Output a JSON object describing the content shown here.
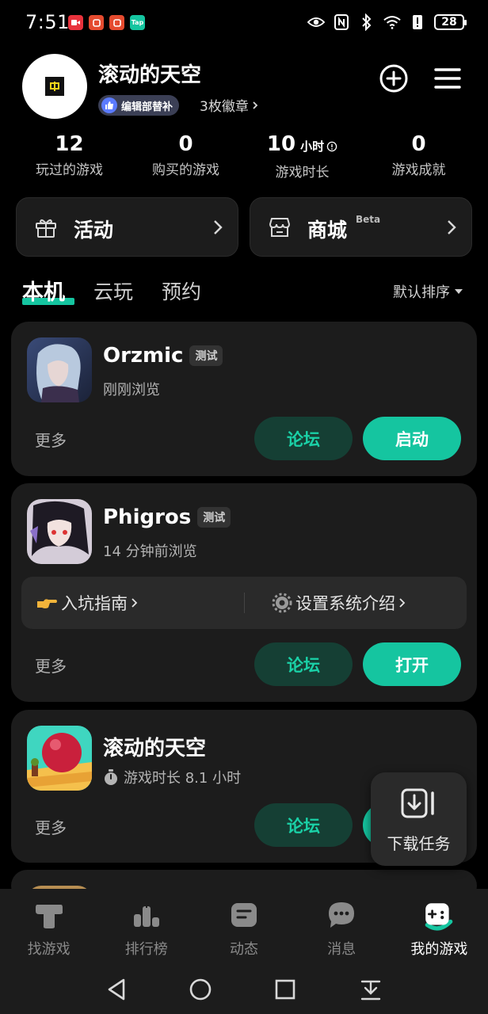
{
  "status_bar": {
    "time": "7:51",
    "battery": "28",
    "app_icons": [
      {
        "name": "video-app-icon",
        "color": "#e8323c",
        "label": ""
      },
      {
        "name": "shop-app-icon-1",
        "color": "#e54b2f",
        "label": ""
      },
      {
        "name": "shop-app-icon-2",
        "color": "#e54b2f",
        "label": ""
      },
      {
        "name": "taptap-app-icon",
        "color": "#15c5a0",
        "label": "Tap"
      }
    ]
  },
  "profile": {
    "username": "滚动的天空",
    "badge_label": "编辑部替补",
    "badge_count": "3枚徽章"
  },
  "stats": [
    {
      "value": "12",
      "unit": "",
      "label": "玩过的游戏"
    },
    {
      "value": "0",
      "unit": "",
      "label": "购买的游戏"
    },
    {
      "value": "10",
      "unit": "小时",
      "label": "游戏时长"
    },
    {
      "value": "0",
      "unit": "",
      "label": "游戏成就"
    }
  ],
  "quick_links": {
    "activity": "活动",
    "shop": "商城",
    "shop_tag": "Beta"
  },
  "tabs": {
    "local": "本机",
    "cloud": "云玩",
    "reserve": "预约",
    "sort": "默认排序"
  },
  "games": [
    {
      "name": "Orzmic",
      "tag": "测试",
      "subtitle": "刚刚浏览",
      "more": "更多",
      "forum": "论坛",
      "action": "启动"
    },
    {
      "name": "Phigros",
      "tag": "测试",
      "subtitle": "14 分钟前浏览",
      "guide_left": "入坑指南",
      "guide_right": "设置系统介绍",
      "more": "更多",
      "forum": "论坛",
      "action": "打开"
    },
    {
      "name": "滚动的天空",
      "tag": "",
      "subtitle": "游戏时长 8.1 小时",
      "more": "更多",
      "forum": "论坛",
      "action": ""
    }
  ],
  "download": {
    "label": "下载任务"
  },
  "bottom_nav": [
    {
      "label": "找游戏",
      "icon": "find-games-icon"
    },
    {
      "label": "排行榜",
      "icon": "leaderboard-icon"
    },
    {
      "label": "动态",
      "icon": "feed-icon"
    },
    {
      "label": "消息",
      "icon": "message-icon"
    },
    {
      "label": "我的游戏",
      "icon": "my-games-icon",
      "active": true
    }
  ],
  "colors": {
    "accent": "#15c5a0",
    "forum_bg": "#153f34",
    "card_bg": "#1c1c1c",
    "background": "#000000"
  }
}
